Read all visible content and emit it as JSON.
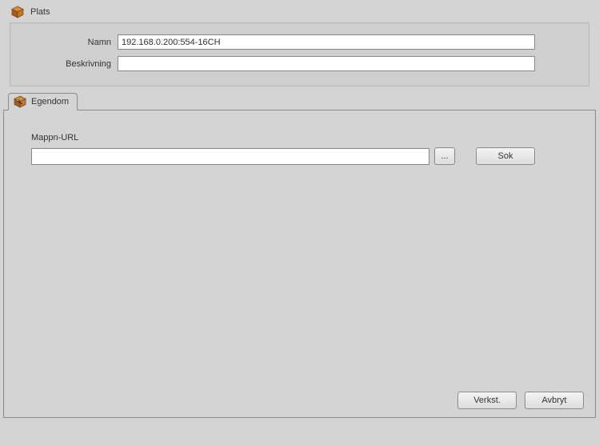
{
  "top": {
    "title": "Plats",
    "rows": {
      "name_label": "Namn",
      "name_value": "192.168.0.200:554-16CH",
      "desc_label": "Beskrivning",
      "desc_value": ""
    }
  },
  "tab": {
    "label": "Egendom",
    "url_label": "Mappn-URL",
    "url_value": "",
    "browse_label": "...",
    "search_label": "Sok"
  },
  "footer": {
    "apply_label": "Verkst.",
    "cancel_label": "Avbryt"
  }
}
